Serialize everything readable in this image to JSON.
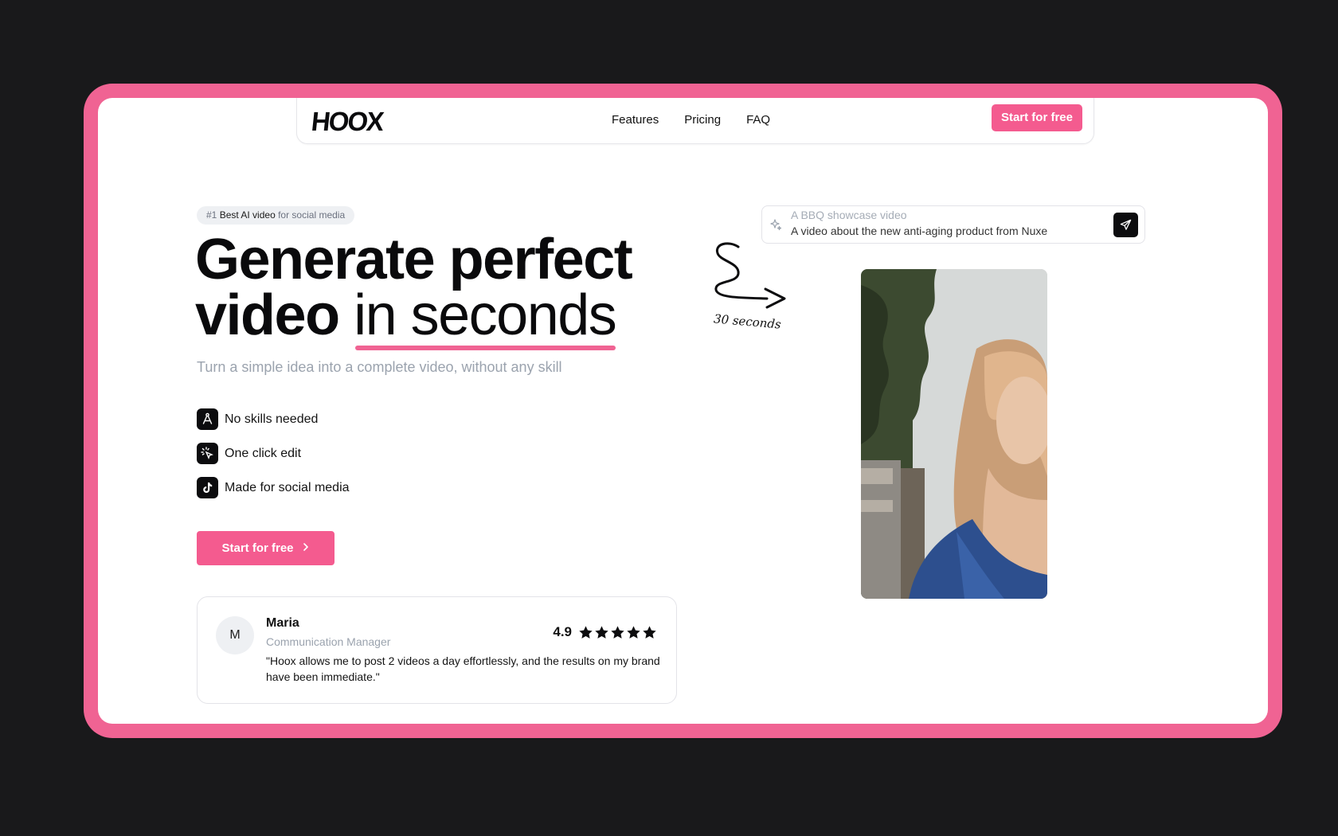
{
  "nav": {
    "logo": "HOOX",
    "links": [
      "Features",
      "Pricing",
      "FAQ"
    ],
    "cta": "Start for free"
  },
  "hero": {
    "badge_rank": "#1",
    "badge_main": "Best AI video",
    "badge_suffix": "for social media",
    "title_line1": "Generate perfect",
    "title_line2_bold": "video",
    "title_line2_thin": "in seconds",
    "subtitle": "Turn a simple idea into a complete video, without any skill",
    "features": [
      {
        "icon": "compass-icon",
        "label": "No skills needed"
      },
      {
        "icon": "magic-click-icon",
        "label": "One click edit"
      },
      {
        "icon": "tiktok-icon",
        "label": "Made for social media"
      }
    ],
    "cta": "Start for free"
  },
  "testimonial": {
    "avatar_initial": "M",
    "name": "Maria",
    "role": "Communication Manager",
    "rating": "4.9",
    "stars": 5,
    "quote": "\"Hoox allows me to post 2 videos a day effortlessly, and the results on my brand have been immediate.\""
  },
  "prompt": {
    "placeholder": "A BBQ showcase video",
    "value": "A video about the new anti-aging product from Nuxe",
    "annotation": "30 seconds"
  },
  "colors": {
    "accent": "#f45b8f",
    "frame": "#f06393",
    "background": "#19191b"
  }
}
